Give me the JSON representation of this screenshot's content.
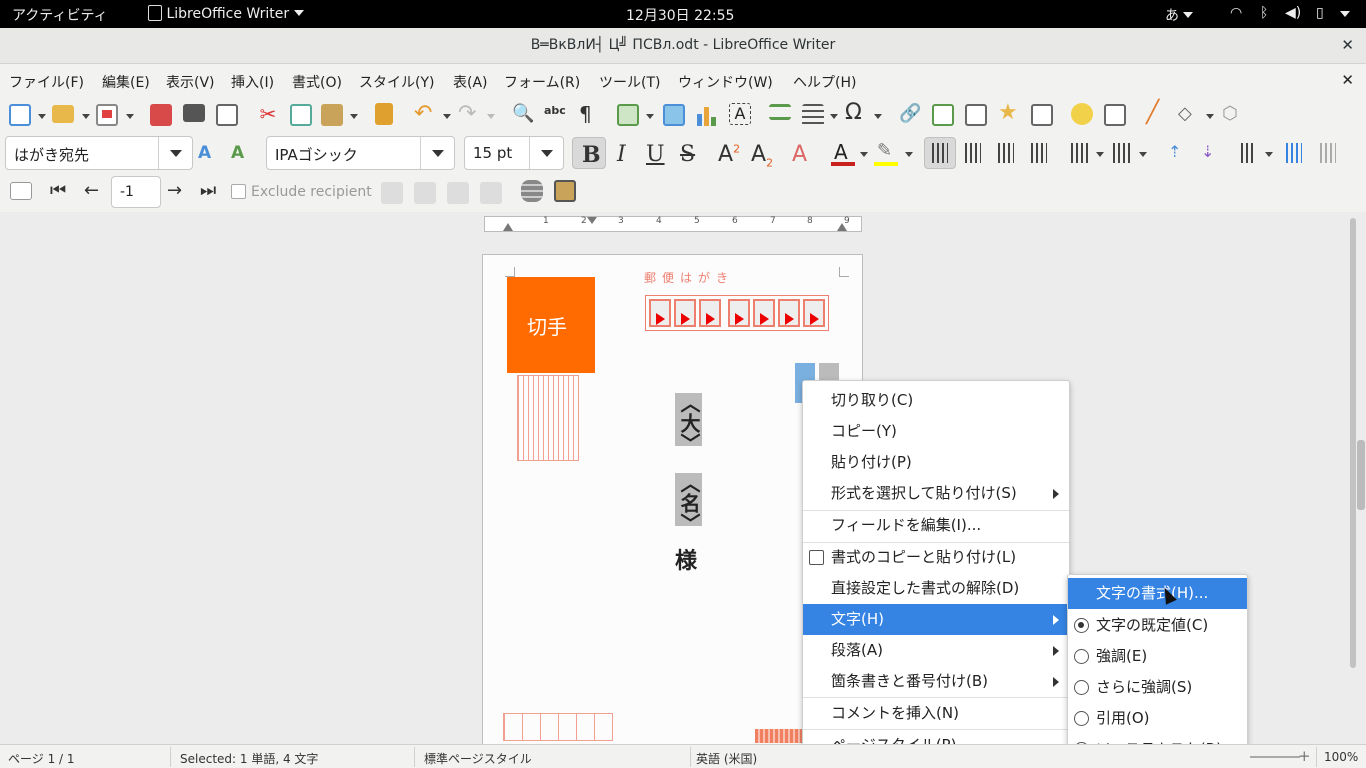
{
  "topbar": {
    "activities": "アクティビティ",
    "app": "LibreOffice Writer",
    "clock": "12月30日  22:55",
    "ime": "あ"
  },
  "window": {
    "title": "B═BкBлИ┤ Ц╝ ПСBл.odt - LibreOffice Writer"
  },
  "menu": [
    "ファイル(F)",
    "編集(E)",
    "表示(V)",
    "挿入(I)",
    "書式(O)",
    "スタイル(Y)",
    "表(A)",
    "フォーム(R)",
    "ツール(T)",
    "ウィンドウ(W)",
    "ヘルプ(H)"
  ],
  "format": {
    "para_style": "はがき宛先",
    "font_name": "IPAゴシック",
    "font_size": "15 pt"
  },
  "mailmerge": {
    "record": "-1",
    "exclude": "Exclude recipient"
  },
  "ruler": [
    "1",
    "2",
    "3",
    "4",
    "5",
    "6",
    "7",
    "8",
    "9"
  ],
  "page": {
    "stamp": "切手",
    "header": "郵便はがき",
    "char1": "︿大﹀",
    "char2": "︿名﹀",
    "sama": "様"
  },
  "context_menu": [
    {
      "label": "切り取り(C)"
    },
    {
      "label": "コピー(Y)"
    },
    {
      "label": "貼り付け(P)"
    },
    {
      "label": "形式を選択して貼り付け(S)",
      "submenu": true
    },
    {
      "label": "フィールドを編集(I)..."
    },
    {
      "label": "書式のコピーと貼り付け(L)",
      "checkbox": true
    },
    {
      "label": "直接設定した書式の解除(D)"
    },
    {
      "label": "文字(H)",
      "submenu": true,
      "highlighted": true
    },
    {
      "label": "段落(A)",
      "submenu": true
    },
    {
      "label": "箇条書きと番号付け(B)",
      "submenu": true
    },
    {
      "label": "コメントを挿入(N)"
    },
    {
      "label": "ページスタイル(P)..."
    }
  ],
  "submenu": [
    {
      "label": "文字の書式(H)...",
      "highlighted": true
    },
    {
      "label": "文字の既定値(C)",
      "radio": "on"
    },
    {
      "label": "強調(E)",
      "radio": "off"
    },
    {
      "label": "さらに強調(S)",
      "radio": "off"
    },
    {
      "label": "引用(O)",
      "radio": "off"
    },
    {
      "label": "ソーステキスト(R)",
      "radio": "off"
    }
  ],
  "status": {
    "page": "ページ 1 / 1",
    "selected": "Selected: 1 単語, 4 文字",
    "page_style": "標準ページスタイル",
    "language": "英語 (米国)",
    "zoom": "100%"
  },
  "colors": {
    "accent": "#3584e4",
    "stamp": "#ff6b00",
    "postal_red": "#ee7f6f"
  }
}
